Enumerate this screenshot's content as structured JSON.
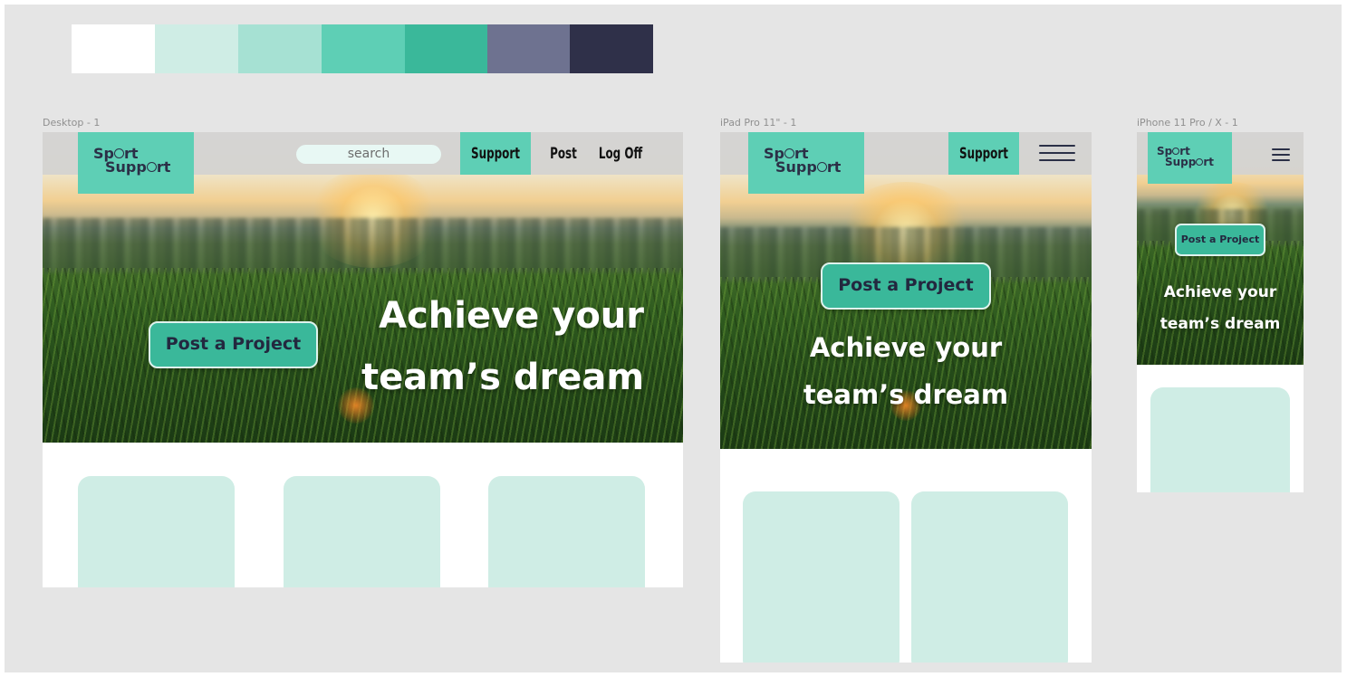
{
  "palette": [
    "#ffffff",
    "#cfede5",
    "#a6e1d3",
    "#5ecfb5",
    "#3ab89a",
    "#6e7290",
    "#2f3049"
  ],
  "frames": {
    "desktop": {
      "label": "Desktop - 1",
      "logo": {
        "line1": "Sp",
        "line1b": "rt",
        "line2": "Supp",
        "line2b": "rt"
      },
      "search_placeholder": "search",
      "nav": {
        "support": "Support",
        "post": "Post",
        "logoff": "Log Off"
      },
      "cta": "Post a Project",
      "headline_line1": "Achieve your",
      "headline_line2": "team’s dream"
    },
    "ipad": {
      "label": "iPad Pro 11\" - 1",
      "logo": {
        "line1": "Sp",
        "line1b": "rt",
        "line2": "Supp",
        "line2b": "rt"
      },
      "nav": {
        "support": "Support"
      },
      "menu_icon": "hamburger-menu-icon",
      "cta": "Post a Project",
      "headline_line1": "Achieve your",
      "headline_line2": "team’s dream"
    },
    "iphone": {
      "label": "iPhone 11 Pro / X - 1",
      "logo": {
        "line1": "Sp",
        "line1b": "rt",
        "line2": "Supp",
        "line2b": "rt"
      },
      "menu_icon": "hamburger-menu-icon",
      "cta": "Post a Project",
      "headline_line1": "Achieve your",
      "headline_line2": "team’s dream"
    }
  }
}
